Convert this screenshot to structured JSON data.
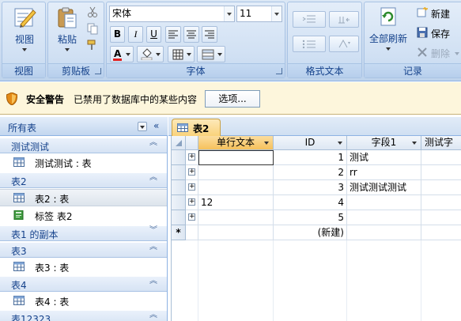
{
  "ribbon": {
    "groups": {
      "views": {
        "title": "视图",
        "view_label": "视图"
      },
      "clipboard": {
        "title": "剪贴板",
        "paste_label": "粘贴"
      },
      "font": {
        "title": "字体",
        "font_name": "宋体",
        "font_size": "11",
        "bold": "B",
        "italic": "I",
        "underline": "U"
      },
      "rich_text": {
        "title": "格式文本"
      },
      "records": {
        "title": "记录",
        "refresh_all_label": "全部刷新",
        "new_label": "新建",
        "save_label": "保存",
        "delete_label": "删除"
      }
    }
  },
  "message_bar": {
    "title": "安全警告",
    "text": "已禁用了数据库中的某些内容",
    "options_label": "选项..."
  },
  "nav_pane": {
    "header": "所有表",
    "groups": [
      {
        "title": "测试测试",
        "items": [
          {
            "label": "测试测试 : 表",
            "type": "table"
          }
        ]
      },
      {
        "title": "表2",
        "items": [
          {
            "label": "表2 : 表",
            "type": "table",
            "selected": true
          },
          {
            "label": "标签 表2",
            "type": "report"
          }
        ]
      },
      {
        "title": "表1 的副本",
        "items": []
      },
      {
        "title": "表3",
        "items": [
          {
            "label": "表3 : 表",
            "type": "table"
          }
        ]
      },
      {
        "title": "表4",
        "items": [
          {
            "label": "表4 : 表",
            "type": "table"
          }
        ]
      },
      {
        "title": "表12323",
        "items": []
      }
    ]
  },
  "document_tab": {
    "label": "表2"
  },
  "datasheet": {
    "columns": [
      "单行文本",
      "ID",
      "字段1",
      "测试字"
    ],
    "rows": [
      {
        "single_line": "",
        "id": "1",
        "field1": "测试"
      },
      {
        "single_line": "",
        "id": "2",
        "field1": "rr"
      },
      {
        "single_line": "",
        "id": "3",
        "field1": "测试测试测试"
      },
      {
        "single_line": "12",
        "id": "4",
        "field1": ""
      },
      {
        "single_line": "",
        "id": "5",
        "field1": ""
      }
    ],
    "new_row_marker": "*",
    "new_row_label": "(新建)"
  },
  "colors": {
    "accent": "#15428b",
    "ribbon_bg": "#c7d9ef",
    "message_bar_bg": "#fdf6dc",
    "selected_header": "#f6c15b"
  }
}
